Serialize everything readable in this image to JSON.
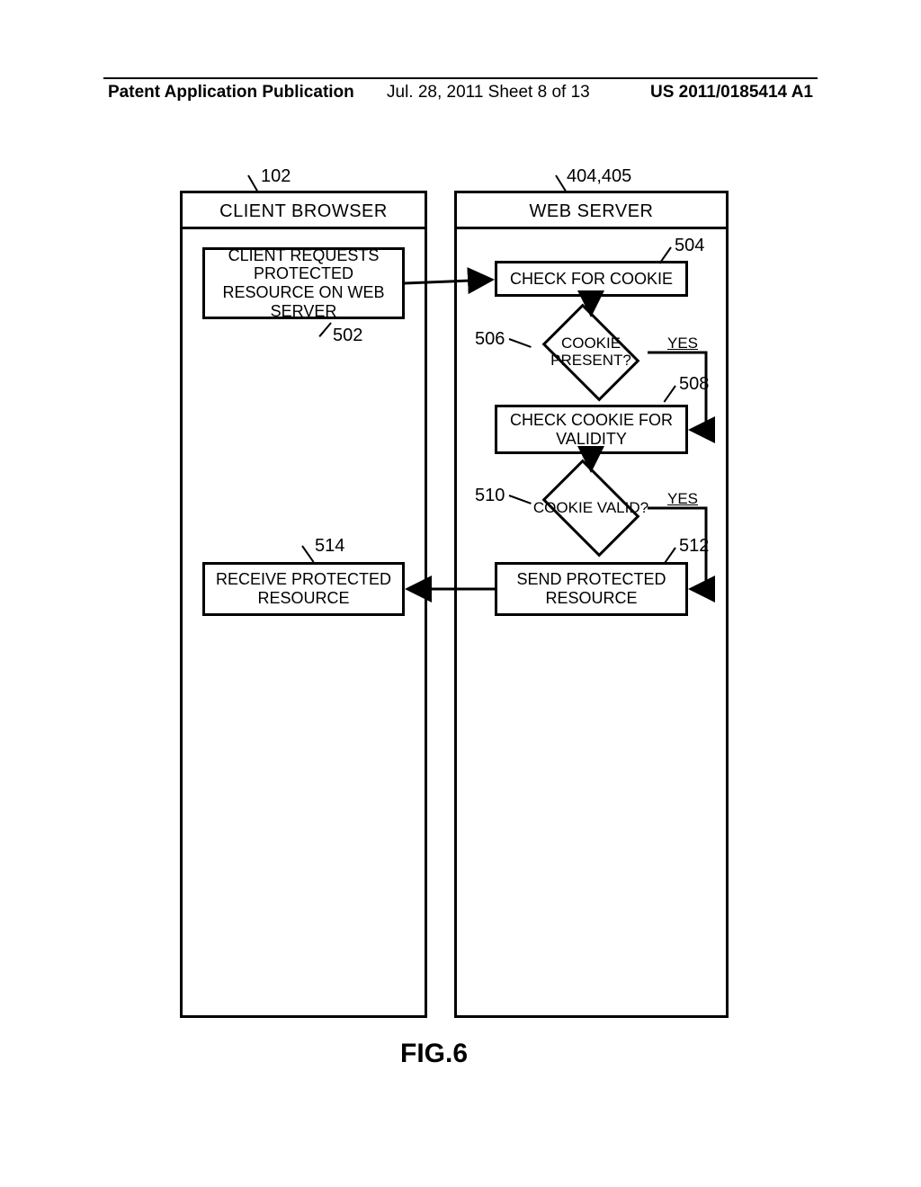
{
  "header": {
    "left": "Patent Application Publication",
    "mid": "Jul. 28, 2011  Sheet 8 of 13",
    "right": "US 2011/0185414 A1"
  },
  "refs": {
    "r102": "102",
    "r404": "404,405",
    "r502": "502",
    "r504": "504",
    "r506": "506",
    "r508": "508",
    "r510": "510",
    "r512": "512",
    "r514": "514"
  },
  "lanes": {
    "client": "CLIENT BROWSER",
    "server": "WEB  SERVER"
  },
  "blocks": {
    "b502": "CLIENT REQUESTS PROTECTED RESOURCE ON WEB SERVER",
    "b504": "CHECK FOR COOKIE",
    "d506": "COOKIE PRESENT?",
    "b508": "CHECK COOKIE FOR VALIDITY",
    "d510": "COOKIE VALID?",
    "b512": "SEND PROTECTED RESOURCE",
    "b514": "RECEIVE PROTECTED RESOURCE"
  },
  "labels": {
    "yes1": "YES",
    "yes2": "YES"
  },
  "figure": "FIG.6"
}
